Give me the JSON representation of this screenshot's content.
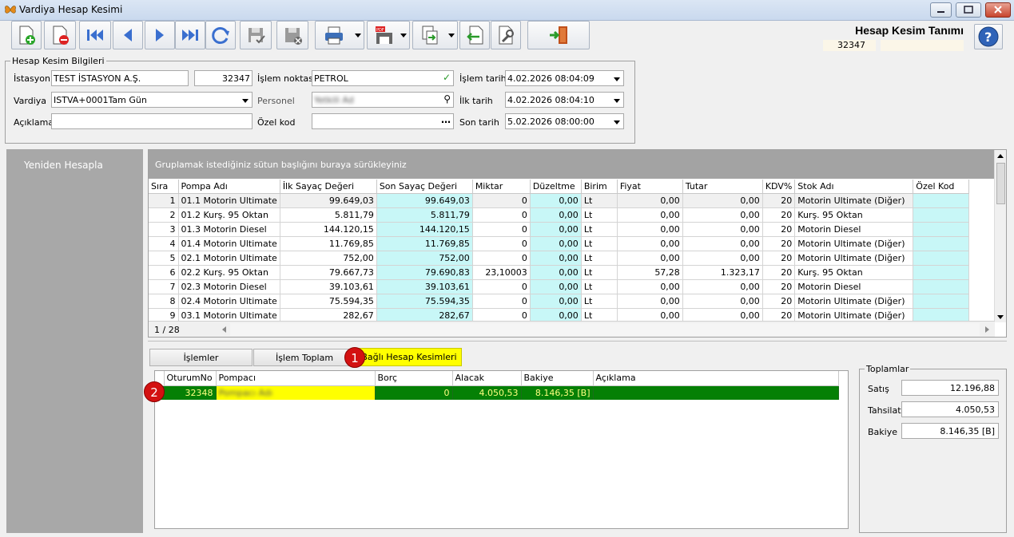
{
  "window": {
    "title": "Vardiya Hesap Kesimi"
  },
  "header": {
    "title": "Hesap Kesim Tanımı",
    "code": "32347"
  },
  "info": {
    "legend": "Hesap Kesim Bilgileri",
    "istasyon_label": "İstasyon",
    "istasyon_value": "TEST İSTASYON A.Ş.",
    "istasyon_code": "32347",
    "islem_noktasi_label": "İşlem noktası",
    "islem_noktasi_value": "PETROL",
    "islem_tarihi_label": "İşlem tarihi",
    "islem_tarihi_value": "4.02.2026 08:04:09",
    "vardiya_label": "Vardiya",
    "vardiya_value": "ISTVA+0001Tam Gün",
    "personel_label": "Personel",
    "personel_value": "Yetkili Ad",
    "ilk_tarih_label": "İlk tarih",
    "ilk_tarih_value": "4.02.2026 08:04:10",
    "aciklama_label": "Açıklama",
    "aciklama_value": "",
    "ozel_kod_label": "Özel kod",
    "ozel_kod_value": "",
    "son_tarih_label": "Son tarih",
    "son_tarih_value": "5.02.2026 08:00:00"
  },
  "left_panel": {
    "recalc_label": "Yeniden Hesapla"
  },
  "main_grid": {
    "group_hint": "Gruplamak istediğiniz sütun başlığını buraya sürükleyiniz",
    "columns": [
      "Sıra",
      "Pompa Adı",
      "İlk Sayaç Değeri",
      "Son Sayaç Değeri",
      "Miktar",
      "Düzeltme",
      "Birim",
      "Fiyat",
      "Tutar",
      "KDV%",
      "Stok Adı",
      "Özel Kod"
    ],
    "rows": [
      [
        "1",
        "01.1 Motorin Ultimate",
        "99.649,03",
        "99.649,03",
        "0",
        "0,00",
        "Lt",
        "0,00",
        "0,00",
        "20",
        "Motorin Ultimate (Diğer)",
        ""
      ],
      [
        "2",
        "01.2 Kurş. 95 Oktan",
        "5.811,79",
        "5.811,79",
        "0",
        "0,00",
        "Lt",
        "0,00",
        "0,00",
        "20",
        "Kurş. 95 Oktan",
        ""
      ],
      [
        "3",
        "01.3 Motorin Diesel",
        "144.120,15",
        "144.120,15",
        "0",
        "0,00",
        "Lt",
        "0,00",
        "0,00",
        "20",
        "Motorin Diesel",
        ""
      ],
      [
        "4",
        "01.4 Motorin Ultimate",
        "11.769,85",
        "11.769,85",
        "0",
        "0,00",
        "Lt",
        "0,00",
        "0,00",
        "20",
        "Motorin Ultimate (Diğer)",
        ""
      ],
      [
        "5",
        "02.1 Motorin Ultimate",
        "752,00",
        "752,00",
        "0",
        "0,00",
        "Lt",
        "0,00",
        "0,00",
        "20",
        "Motorin Ultimate (Diğer)",
        ""
      ],
      [
        "6",
        "02.2 Kurş. 95 Oktan",
        "79.667,73",
        "79.690,83",
        "23,10003",
        "0,00",
        "Lt",
        "57,28",
        "1.323,17",
        "20",
        "Kurş. 95 Oktan",
        ""
      ],
      [
        "7",
        "02.3 Motorin Diesel",
        "39.103,61",
        "39.103,61",
        "0",
        "0,00",
        "Lt",
        "0,00",
        "0,00",
        "20",
        "Motorin Diesel",
        ""
      ],
      [
        "8",
        "02.4 Motorin Ultimate",
        "75.594,35",
        "75.594,35",
        "0",
        "0,00",
        "Lt",
        "0,00",
        "0,00",
        "20",
        "Motorin Ultimate (Diğer)",
        ""
      ],
      [
        "9",
        "03.1 Motorin Ultimate",
        "282,67",
        "282,67",
        "0",
        "0,00",
        "Lt",
        "0,00",
        "0,00",
        "20",
        "Motorin Ultimate (Diğer)",
        ""
      ]
    ],
    "record_count": "1 / 28"
  },
  "tabs": [
    {
      "label": "İşlemler"
    },
    {
      "label": "İşlem Toplam"
    },
    {
      "label": "Bağlı Hesap Kesimleri"
    }
  ],
  "badges": [
    "1",
    "2"
  ],
  "sub_grid": {
    "columns": [
      "OturumNo",
      "Pompacı",
      "Borç",
      "Alacak",
      "Bakiye",
      "Açıklama"
    ],
    "rows": [
      [
        "32348",
        "Pompacı Adı",
        "0",
        "4.050,53",
        "8.146,35 [B]",
        ""
      ]
    ]
  },
  "totals": {
    "legend": "Toplamlar",
    "satis_label": "Satış",
    "satis_value": "12.196,88",
    "tahsilat_label": "Tahsilat",
    "tahsilat_value": "4.050,53",
    "bakiye_label": "Bakiye",
    "bakiye_value": "8.146,35 [B]"
  },
  "colors": {
    "accent_yellow": "#ffff00",
    "row_green": "#058005",
    "cyan_cell": "#c8f7f7",
    "badge_red": "#d31111"
  }
}
